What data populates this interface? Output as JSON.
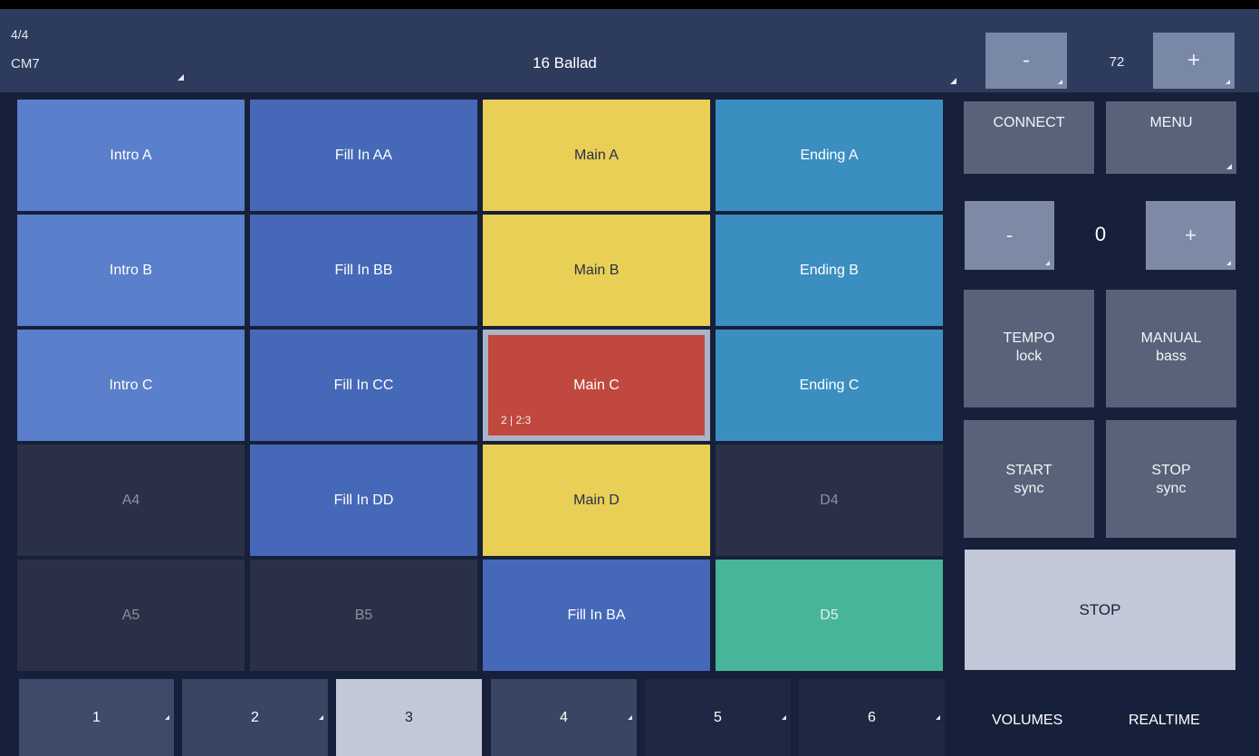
{
  "header": {
    "time_signature": "4/4",
    "chord": "CM7",
    "style_name": "16 Ballad",
    "tempo_minus_label": "-",
    "tempo_value": "72",
    "tempo_plus_label": "+"
  },
  "pads": [
    [
      "Intro A",
      "Fill In AA",
      "Main A",
      "Ending A"
    ],
    [
      "Intro B",
      "Fill In BB",
      "Main B",
      "Ending B"
    ],
    [
      "Intro C",
      "Fill In CC",
      "Main C",
      "Ending C"
    ],
    [
      "A4",
      "Fill In DD",
      "Main D",
      "D4"
    ],
    [
      "A5",
      "B5",
      "Fill In BA",
      "D5"
    ]
  ],
  "active_pad_position": "2 | 2:3",
  "side": {
    "connect_label": "CONNECT",
    "menu_label": "MENU",
    "transpose_minus_label": "-",
    "transpose_value": "0",
    "transpose_plus_label": "+",
    "tempo_lock": {
      "line1": "TEMPO",
      "line2": "lock"
    },
    "manual_bass": {
      "line1": "MANUAL",
      "line2": "bass"
    },
    "start_sync": {
      "line1": "START",
      "line2": "sync"
    },
    "stop_sync": {
      "line1": "STOP",
      "line2": "sync"
    },
    "stop_label": "STOP",
    "volumes_label": "VOLUMES",
    "realtime_label": "REALTIME"
  },
  "variation_tabs": [
    "1",
    "2",
    "3",
    "4",
    "5",
    "6"
  ],
  "selected_tab": "3",
  "colors": {
    "intro_blue": "#5a7fcb",
    "fill_blue": "#4668b8",
    "main_yellow": "#e9cf55",
    "ending_teal": "#3b8ec0",
    "active_red": "#c0483f",
    "empty_dark": "#2a3146",
    "accent_green": "#47b59a"
  }
}
